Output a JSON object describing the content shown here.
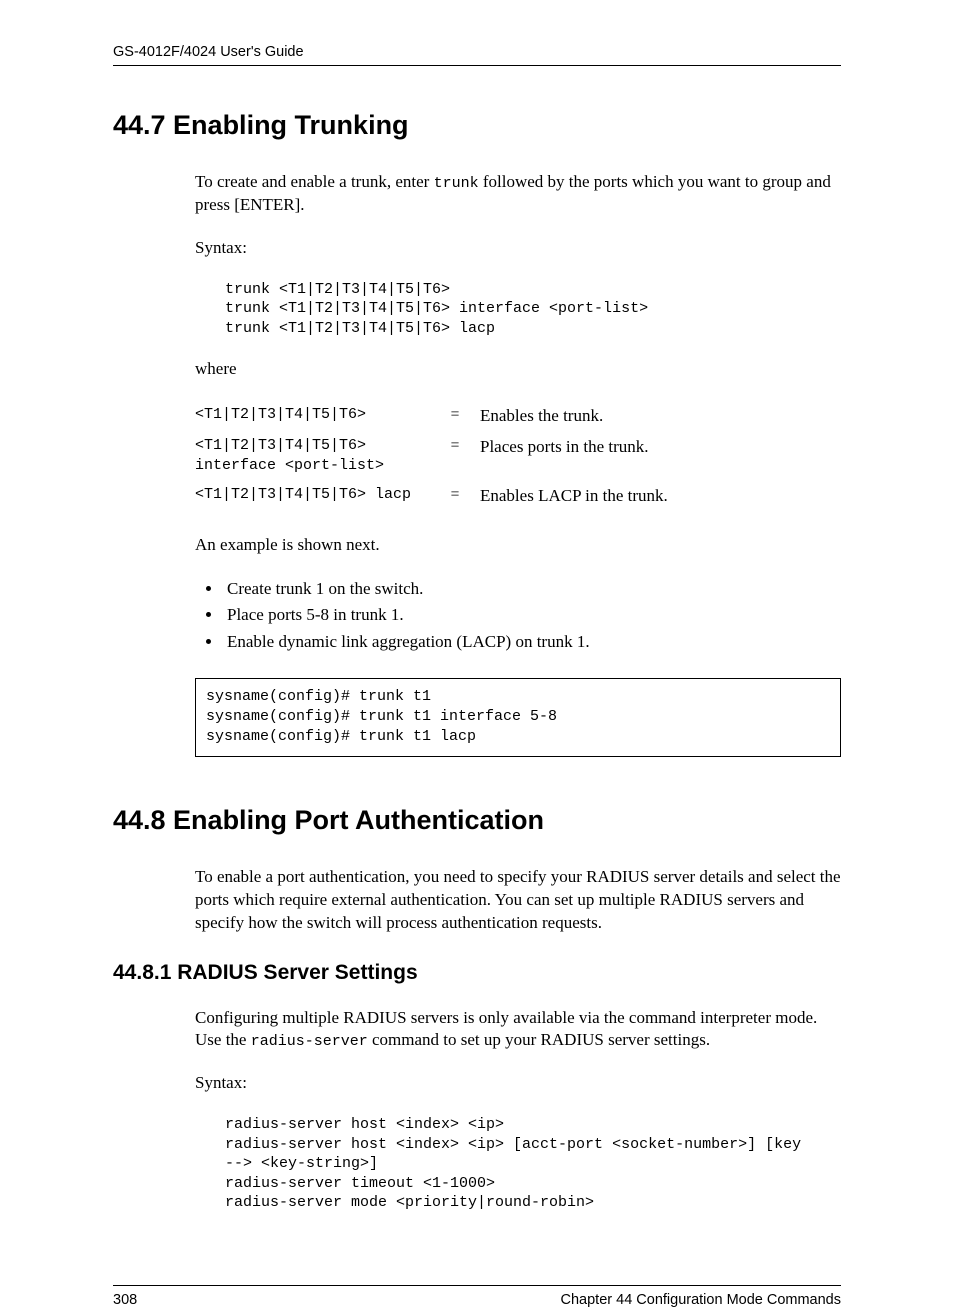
{
  "header": {
    "guide_title": "GS-4012F/4024 User's Guide"
  },
  "section_447": {
    "heading": "44.7  Enabling Trunking",
    "intro_pre": "To create and enable a trunk, enter ",
    "intro_code": "trunk",
    "intro_post": " followed by the ports which you want to group and press  [ENTER].",
    "syntax_label": "Syntax:",
    "syntax_block": "trunk <T1|T2|T3|T4|T5|T6>\ntrunk <T1|T2|T3|T4|T5|T6> interface <port-list>\ntrunk <T1|T2|T3|T4|T5|T6> lacp",
    "where_label": "where",
    "defs": [
      {
        "term": "<T1|T2|T3|T4|T5|T6>",
        "eq": "=",
        "desc": "Enables the trunk."
      },
      {
        "term": "<T1|T2|T3|T4|T5|T6>\ninterface <port-list>",
        "eq": "=",
        "desc": "Places ports in the trunk."
      },
      {
        "term": "<T1|T2|T3|T4|T5|T6> lacp",
        "eq": "=",
        "desc": "Enables LACP in the trunk."
      }
    ],
    "example_intro": "An example is shown next.",
    "bullets": [
      "Create trunk 1 on the switch.",
      "Place ports 5-8 in trunk 1.",
      "Enable dynamic link aggregation (LACP) on trunk 1."
    ],
    "example_code": "sysname(config)# trunk t1\nsysname(config)# trunk t1 interface 5-8\nsysname(config)# trunk t1 lacp"
  },
  "section_448": {
    "heading": "44.8  Enabling Port Authentication",
    "intro": "To enable a port authentication, you need to specify your RADIUS server details and select the ports which require external authentication. You can set up multiple RADIUS servers and specify how the switch will process authentication requests.",
    "sub_heading": "44.8.1  RADIUS Server Settings",
    "sub_intro_pre": "Configuring multiple RADIUS servers is only available via the command interpreter mode. Use the ",
    "sub_intro_code": "radius-server",
    "sub_intro_post": " command to set up your RADIUS server settings.",
    "syntax_label": "Syntax:",
    "syntax_block": "radius-server host <index> <ip>\nradius-server host <index> <ip> [acct-port <socket-number>] [key\n--> <key-string>]\nradius-server timeout <1-1000>\nradius-server mode <priority|round-robin>"
  },
  "footer": {
    "page_number": "308",
    "chapter": "Chapter 44 Configuration Mode Commands"
  }
}
